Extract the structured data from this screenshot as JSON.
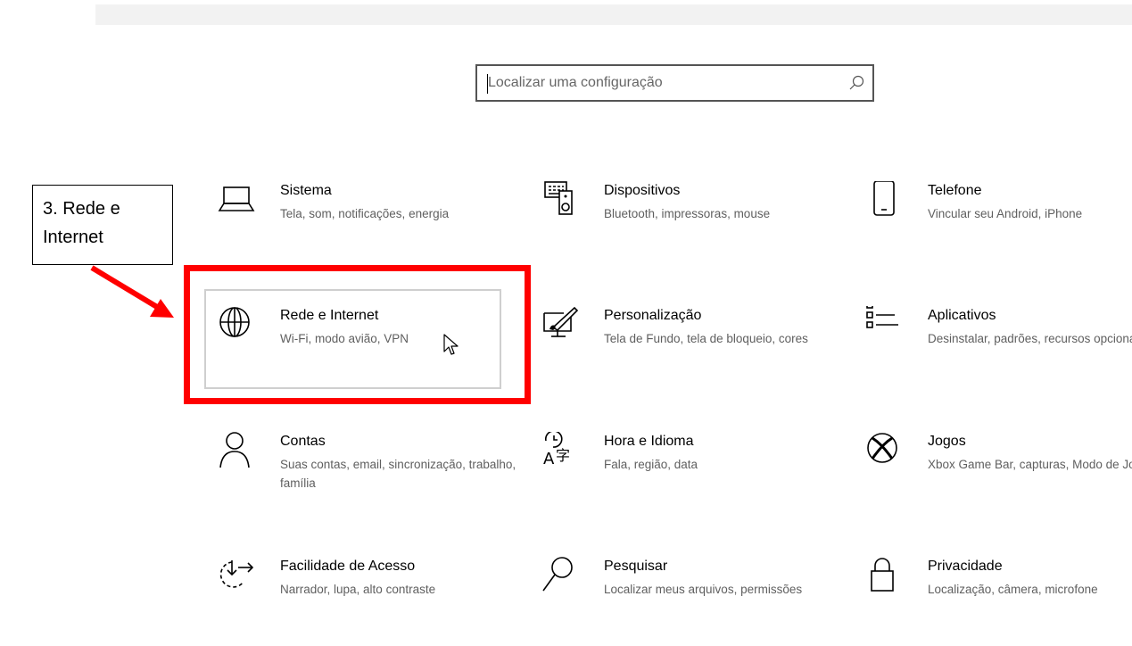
{
  "search": {
    "placeholder": "Localizar uma configuração",
    "icon": "search-icon"
  },
  "callout": {
    "line1": "3. Rede e",
    "line2": "Internet"
  },
  "tiles": [
    {
      "title": "Sistema",
      "desc": "Tela, som, notificações, energia",
      "icon": "laptop-icon"
    },
    {
      "title": "Dispositivos",
      "desc": "Bluetooth, impressoras, mouse",
      "icon": "keyboard-speaker-icon"
    },
    {
      "title": "Telefone",
      "desc": "Vincular seu Android, iPhone",
      "icon": "phone-icon"
    },
    {
      "title": "Rede e Internet",
      "desc": "Wi-Fi, modo avião, VPN",
      "icon": "globe-icon"
    },
    {
      "title": "Personalização",
      "desc": "Tela de Fundo, tela de bloqueio, cores",
      "icon": "paint-screen-icon"
    },
    {
      "title": "Aplicativos",
      "desc": "Desinstalar, padrões, recursos opcionais",
      "icon": "app-list-icon"
    },
    {
      "title": "Contas",
      "desc": "Suas contas, email, sincronização, trabalho, família",
      "icon": "person-icon"
    },
    {
      "title": "Hora e Idioma",
      "desc": "Fala, região, data",
      "icon": "time-language-icon"
    },
    {
      "title": "Jogos",
      "desc": "Xbox Game Bar, capturas, Modo de Jogo",
      "icon": "xbox-icon"
    },
    {
      "title": "Facilidade de Acesso",
      "desc": "Narrador, lupa, alto contraste",
      "icon": "ease-of-access-icon"
    },
    {
      "title": "Pesquisar",
      "desc": "Localizar meus arquivos, permissões",
      "icon": "search-magnifier-icon"
    },
    {
      "title": "Privacidade",
      "desc": "Localização, câmera, microfone",
      "icon": "lock-icon"
    }
  ],
  "colors": {
    "highlight": "#ff0000",
    "hover_border": "#cfcfcf",
    "topbar": "#f2f2f2"
  }
}
